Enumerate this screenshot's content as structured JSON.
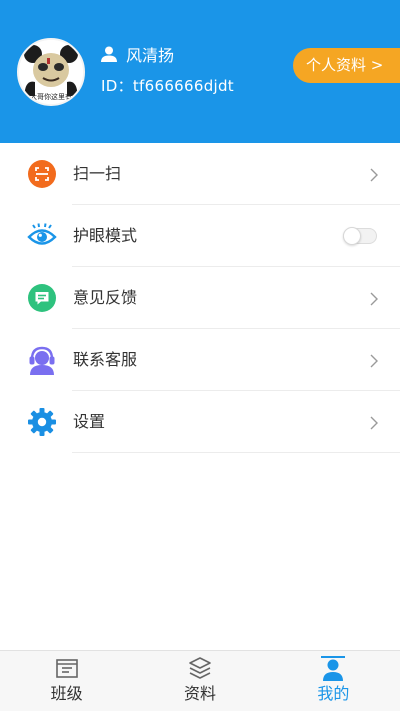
{
  "colors": {
    "header_bg": "#1a95e8",
    "profile_button_bg": "#f5a623",
    "active_tab": "#1a95e8",
    "scan_icon": "#f26b1d",
    "eye_icon": "#1a95e8",
    "feedback_icon": "#2ec27e",
    "service_icon": "#7a6ff0",
    "settings_icon": "#1a8fe3"
  },
  "header": {
    "avatar_caption": "大哥你这里有",
    "username": "风清扬",
    "user_id": "ID：tf666666djdt",
    "profile_button": "个人资料 >"
  },
  "menu": {
    "items": [
      {
        "label": "扫一扫",
        "icon": "scan-icon",
        "trailing": "chevron"
      },
      {
        "label": "护眼模式",
        "icon": "eye-icon",
        "trailing": "toggle",
        "toggle_on": false
      },
      {
        "label": "意见反馈",
        "icon": "feedback-icon",
        "trailing": "chevron"
      },
      {
        "label": "联系客服",
        "icon": "customer-service-icon",
        "trailing": "chevron"
      },
      {
        "label": "设置",
        "icon": "gear-icon",
        "trailing": "chevron"
      }
    ]
  },
  "tabbar": {
    "tabs": [
      {
        "label": "班级",
        "icon": "class-icon",
        "active": false
      },
      {
        "label": "资料",
        "icon": "layers-icon",
        "active": false
      },
      {
        "label": "我的",
        "icon": "person-icon",
        "active": true
      }
    ]
  }
}
